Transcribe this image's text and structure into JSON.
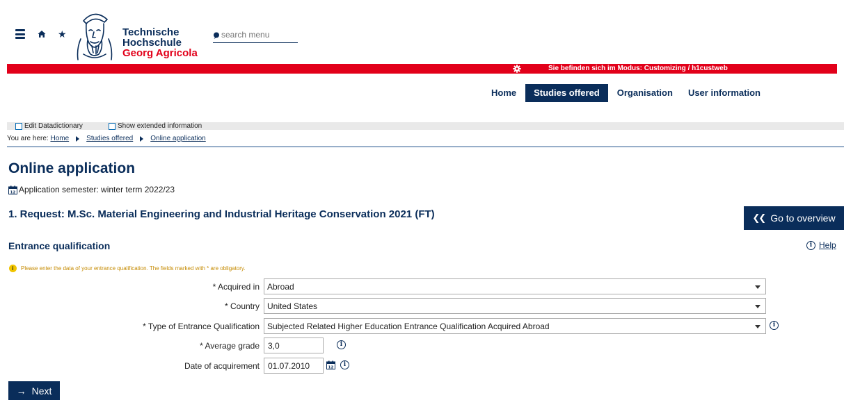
{
  "header": {
    "logo_line1": "Technische",
    "logo_line2": "Hochschule",
    "logo_line3": "Georg Agricola",
    "search_placeholder": "search menu",
    "mode_text": "Sie befinden sich im Modus: Customizing / h1custweb"
  },
  "nav": {
    "items": [
      "Home",
      "Studies offered",
      "Organisation",
      "User information"
    ],
    "active": "Studies offered"
  },
  "toolbar": {
    "edit_datadictionary": "Edit Datadictionary",
    "show_extended": "Show extended information"
  },
  "breadcrumb": {
    "prefix": "You are here:",
    "items": [
      "Home",
      "Studies offered",
      "Online application"
    ]
  },
  "page": {
    "title": "Online application",
    "semester": "Application semester: winter term 2022/23",
    "request_title": "1. Request: M.Sc. Material Engineering and Industrial Heritage Conservation 2021 (FT)",
    "overview_button": "Go to overview",
    "section_title": "Entrance qualification",
    "help_label": "Help",
    "hint": "Please enter the data of your entrance qualification. The fields marked with * are obligatory.",
    "next_button": "Next"
  },
  "form": {
    "acquired_in": {
      "label": "* Acquired in",
      "value": "Abroad"
    },
    "country": {
      "label": "* Country",
      "value": "United States"
    },
    "type": {
      "label": "* Type of Entrance Qualification",
      "value": "Subjected Related Higher Education Entrance Qualification Acquired Abroad"
    },
    "grade": {
      "label": "* Average grade",
      "value": "3,0"
    },
    "date": {
      "label": "Date of acquirement",
      "value": "01.07.2010"
    }
  },
  "colors": {
    "brand_blue": "#0a2d5a",
    "brand_red": "#e2001a",
    "hint_yellow": "#f0c400"
  }
}
